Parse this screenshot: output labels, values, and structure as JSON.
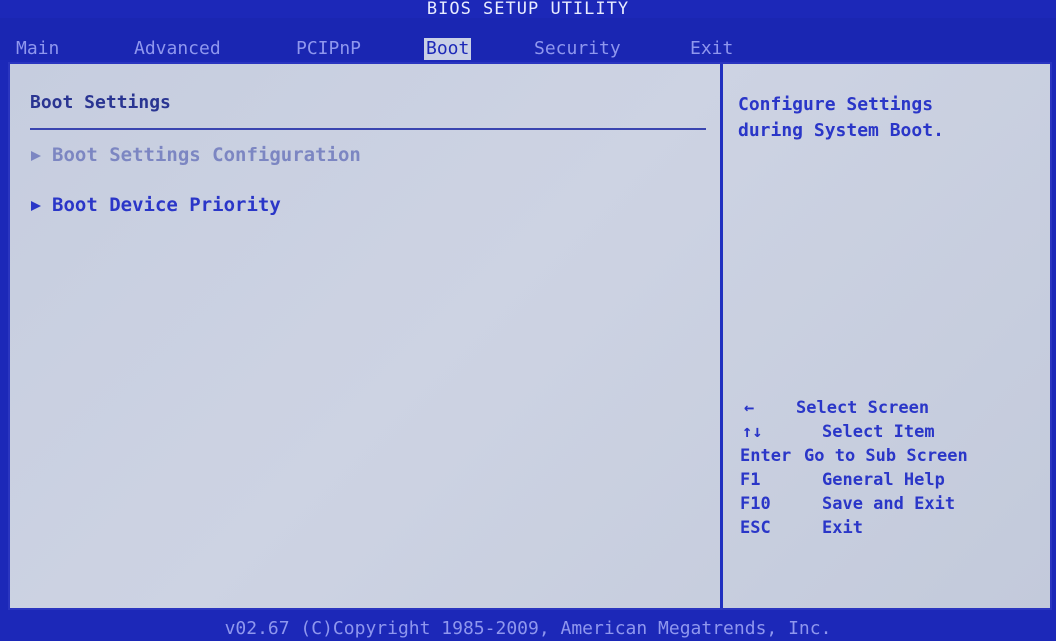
{
  "title": "BIOS SETUP UTILITY",
  "tabs": [
    {
      "label": "Main",
      "active": false
    },
    {
      "label": "Advanced",
      "active": false
    },
    {
      "label": "PCIPnP",
      "active": false
    },
    {
      "label": "Boot",
      "active": true
    },
    {
      "label": "Security",
      "active": false
    },
    {
      "label": "Exit",
      "active": false
    }
  ],
  "section": {
    "title": "Boot Settings"
  },
  "items": [
    {
      "label": "Boot Settings Configuration",
      "icon": "submenu-arrow-icon"
    },
    {
      "label": "Boot Device Priority",
      "icon": "submenu-arrow-icon"
    }
  ],
  "help": {
    "text": "Configure Settings\nduring System Boot."
  },
  "keys": [
    {
      "key": "←",
      "desc": "Select Screen"
    },
    {
      "key": "↑↓",
      "desc": "Select Item"
    },
    {
      "key": "Enter",
      "desc": "Go to Sub Screen"
    },
    {
      "key": "F1",
      "desc": "General Help"
    },
    {
      "key": "F10",
      "desc": "Save and Exit"
    },
    {
      "key": "ESC",
      "desc": "Exit"
    }
  ],
  "footer": "v02.67 (C)Copyright 1985-2009, American Megatrends, Inc.",
  "colors": {
    "background": "#1c28b8",
    "panel": "#c9d0e2",
    "accent": "#2a36c8",
    "selected_item": "#7c86c2"
  }
}
